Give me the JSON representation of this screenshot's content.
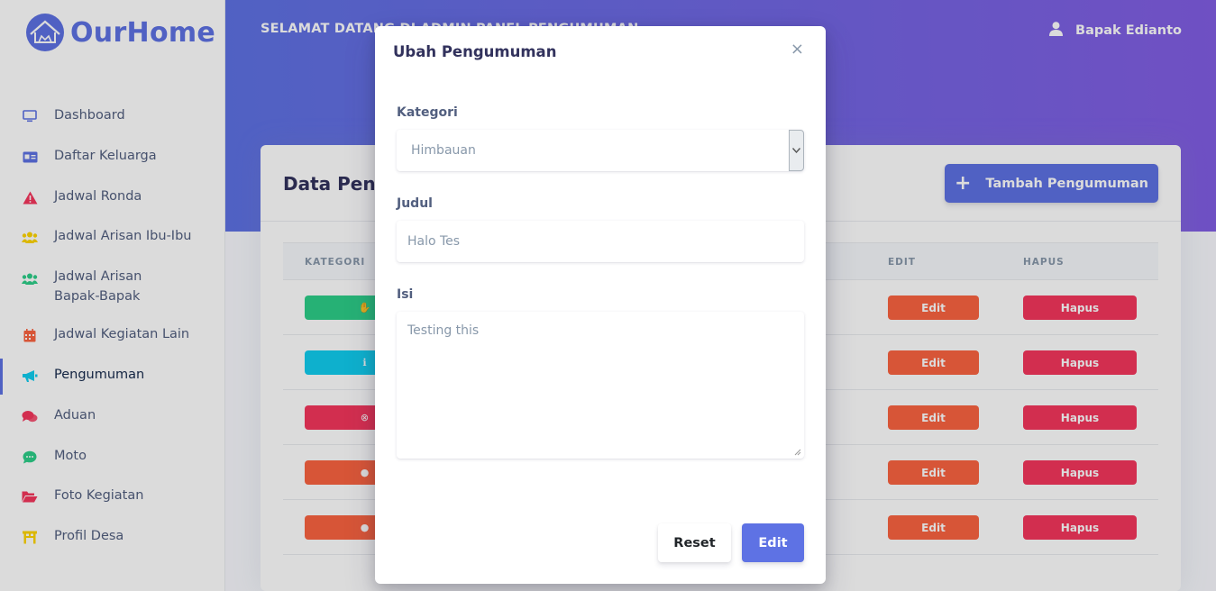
{
  "brand": {
    "name": "OurHome"
  },
  "sidebar": {
    "items": [
      {
        "label": "Dashboard",
        "icon": "monitor-icon",
        "color": "#5e72e4"
      },
      {
        "label": "Daftar Keluarga",
        "icon": "id-card-icon",
        "color": "#5e72e4"
      },
      {
        "label": "Jadwal Ronda",
        "icon": "warning-icon",
        "color": "#f5365c"
      },
      {
        "label": "Jadwal Arisan Ibu-Ibu",
        "icon": "users-icon",
        "color": "#ffd600"
      },
      {
        "label": "Jadwal Arisan Bapak-Bapak",
        "icon": "users-icon",
        "color": "#2dce89"
      },
      {
        "label": "Jadwal Kegiatan Lain",
        "icon": "calendar-icon",
        "color": "#fb6340"
      },
      {
        "label": "Pengumuman",
        "icon": "megaphone-icon",
        "color": "#11cdef",
        "active": true
      },
      {
        "label": "Aduan",
        "icon": "comments-icon",
        "color": "#f5365c"
      },
      {
        "label": "Moto",
        "icon": "chat-icon",
        "color": "#2dce89"
      },
      {
        "label": "Foto Kegiatan",
        "icon": "folder-open-icon",
        "color": "#f5365c"
      },
      {
        "label": "Profil Desa",
        "icon": "gate-icon",
        "color": "#ffd600"
      }
    ]
  },
  "header": {
    "welcome": "SELAMAT DATANG DI ADMIN PANEL PENGUMUMAN",
    "user_name": "Bapak Edianto"
  },
  "card": {
    "title": "Data Pengumuman",
    "add_button": "Tambah Pengumuman",
    "columns": {
      "kategori": "KATEGORI",
      "edit": "EDIT",
      "hapus": "HAPUS"
    },
    "rows": [
      {
        "category_color": "#2dce89",
        "category_icon": "hand-icon",
        "edit": "Edit",
        "delete": "Hapus"
      },
      {
        "category_color": "#11cdef",
        "category_icon": "info-icon",
        "edit": "Edit",
        "delete": "Hapus"
      },
      {
        "category_color": "#f5365c",
        "category_icon": "times-circle-icon",
        "edit": "Edit",
        "delete": "Hapus"
      },
      {
        "category_color": "#fb6340",
        "category_icon": "bell-icon",
        "edit": "Edit",
        "delete": "Hapus"
      },
      {
        "category_color": "#fb6340",
        "category_icon": "bell-icon",
        "edit": "Edit",
        "delete": "Hapus"
      }
    ]
  },
  "modal": {
    "title": "Ubah Pengumuman",
    "close": "×",
    "kategori_label": "Kategori",
    "kategori_value": "Himbauan",
    "judul_label": "Judul",
    "judul_value": "Halo Tes",
    "isi_label": "Isi",
    "isi_value": "Testing this",
    "reset_button": "Reset",
    "submit_button": "Edit"
  }
}
